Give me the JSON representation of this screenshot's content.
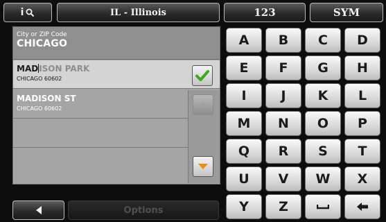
{
  "topbar": {
    "info_label": "i",
    "state_label": "IL - Illinois",
    "numeric_label": "123",
    "symbol_label": "SYM"
  },
  "city_field": {
    "label": "City or ZIP Code",
    "value": "CHICAGO"
  },
  "results": [
    {
      "typed": "MAD",
      "rest": "ISON PARK",
      "sub": "CHICAGO 60602",
      "selected": true
    },
    {
      "name": "MADISON ST",
      "sub": "CHICAGO 60602",
      "selected": false
    }
  ],
  "keyboard": {
    "rows": [
      [
        "A",
        "B",
        "C",
        "D"
      ],
      [
        "E",
        "F",
        "G",
        "H"
      ],
      [
        "I",
        "J",
        "K",
        "L"
      ],
      [
        "M",
        "N",
        "O",
        "P"
      ],
      [
        "Q",
        "R",
        "S",
        "T"
      ],
      [
        "U",
        "V",
        "W",
        "X"
      ],
      [
        "Y",
        "Z"
      ]
    ]
  },
  "bottombar": {
    "options_label": "Options"
  },
  "colors": {
    "check_green": "#3aaa1a",
    "down_orange": "#f08a10"
  }
}
